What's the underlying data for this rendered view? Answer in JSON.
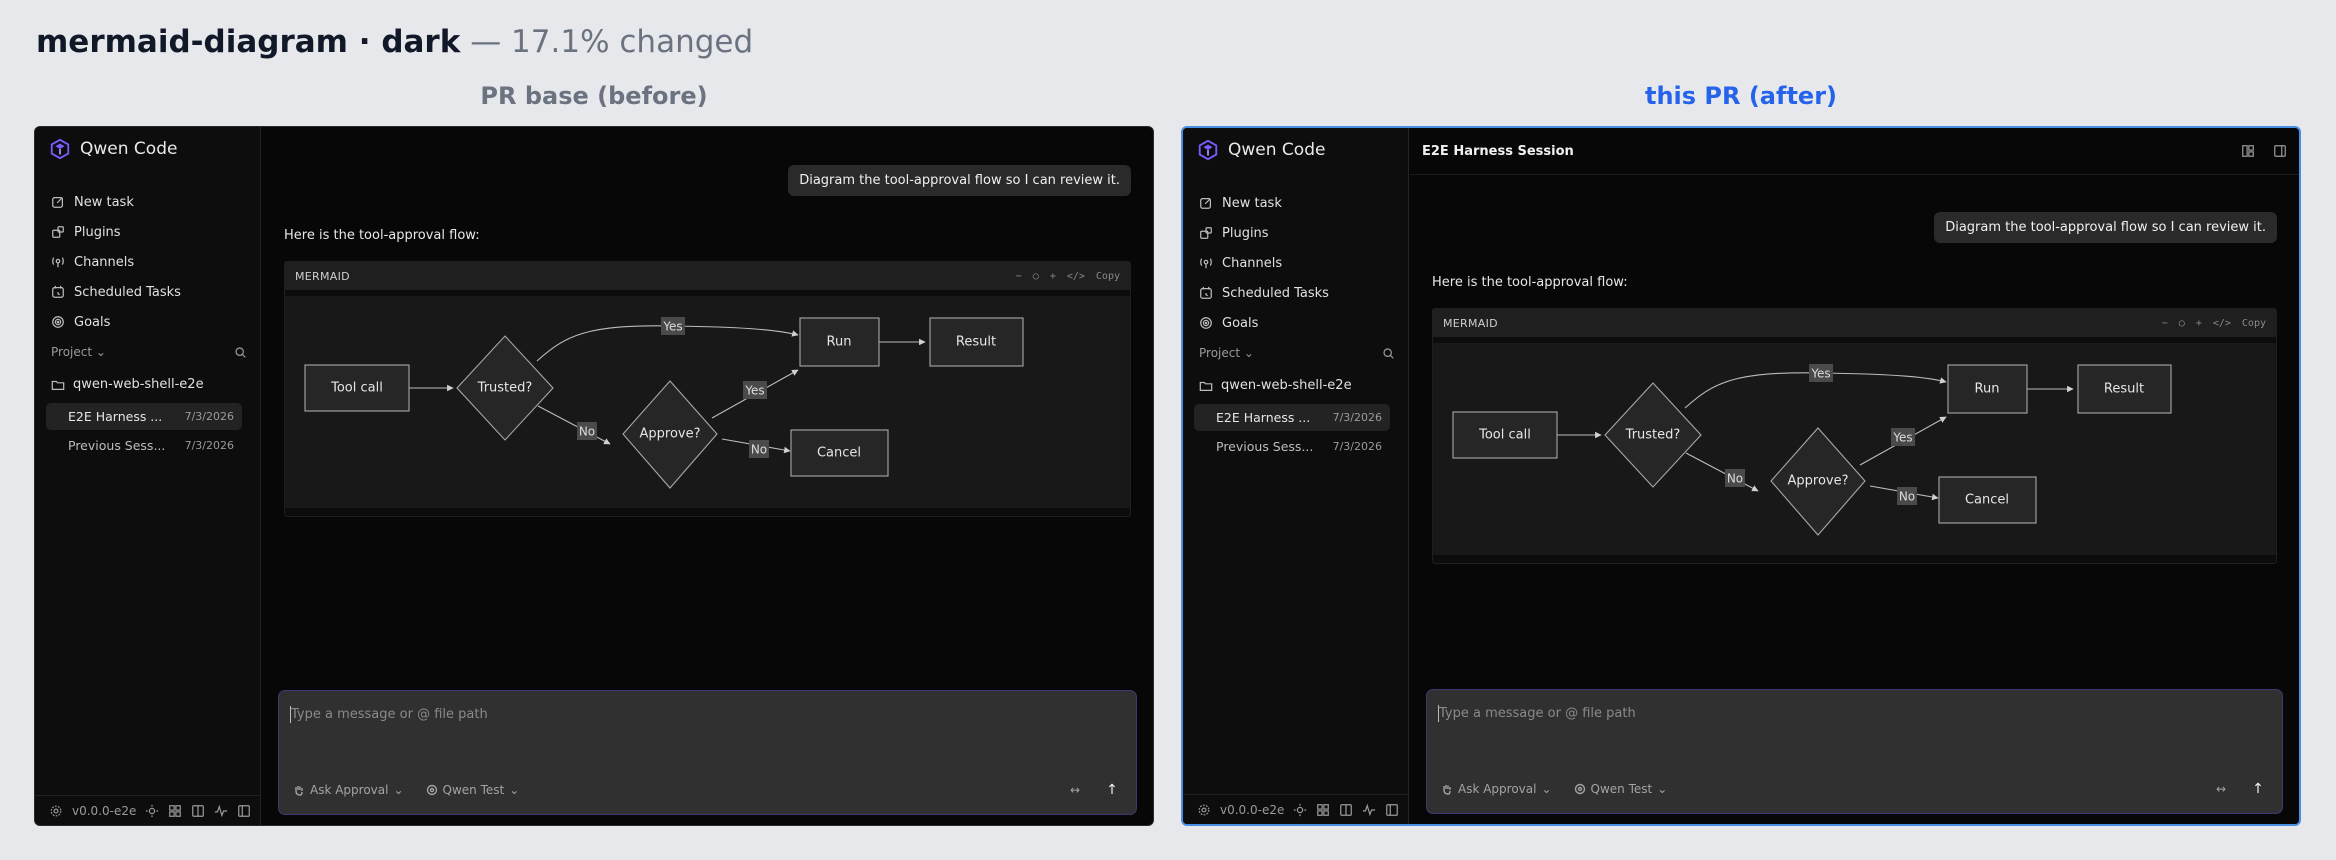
{
  "header": {
    "title": "mermaid-diagram · dark",
    "subtitle": "— 17.1% changed"
  },
  "columns": {
    "before_label": "PR base (before)",
    "after_label": "this PR (after)"
  },
  "app": {
    "brand": "Qwen Code",
    "nav": [
      "New task",
      "Plugins",
      "Channels",
      "Scheduled Tasks",
      "Goals"
    ],
    "project_label": "Project",
    "folder": "qwen-web-shell-e2e",
    "sessions": [
      {
        "title": "E2E Harness ...",
        "date": "7/3/2026"
      },
      {
        "title": "Previous Sess...",
        "date": "7/3/2026"
      }
    ],
    "version": "v0.0.0-e2e",
    "session_title": "E2E Harness Session",
    "user_message": "Diagram the tool-approval flow so I can review it.",
    "assistant_message": "Here is the tool-approval flow:",
    "mermaid": {
      "label": "MERMAID",
      "tools": [
        "−",
        "○",
        "+",
        "</>",
        "Copy"
      ]
    },
    "diagram": {
      "nodes": {
        "tool_call": "Tool call",
        "trusted": "Trusted?",
        "approve": "Approve?",
        "run": "Run",
        "result": "Result",
        "cancel": "Cancel"
      },
      "edges": {
        "yes1": "Yes",
        "yes2": "Yes",
        "no1": "No",
        "no2": "No"
      }
    },
    "composer": {
      "placeholder": "Type a message or @ file path",
      "approval": "Ask Approval",
      "model": "Qwen Test",
      "send": "↑"
    }
  }
}
